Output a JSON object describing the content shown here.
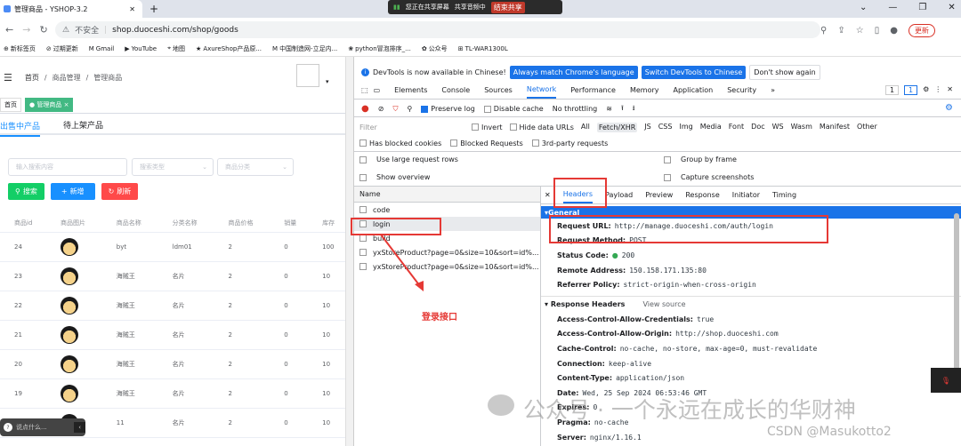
{
  "browser": {
    "tab_title": "管理商品 - YSHOP-3.2",
    "share_status": "您正在共享屏幕",
    "share_audio": "共享音频中",
    "share_stop": "结束共享",
    "security": "不安全",
    "url": "shop.duoceshi.com/shop/goods",
    "update_btn": "更新",
    "bookmarks": [
      "新标签页",
      "过期更新",
      "Gmail",
      "YouTube",
      "地图",
      "AxureShop产品原...",
      "中国制造网-立足内...",
      "python冒泡排序_...",
      "公众号",
      "TL-WAR1300L"
    ]
  },
  "app": {
    "breadcrumb": [
      "首页",
      "商品管理",
      "管理商品"
    ],
    "tags": [
      "首页",
      "管理商品"
    ],
    "subtabs": [
      "出售中产品",
      "待上架产品"
    ],
    "search_placeholder": "输入搜索内容",
    "search_type": "搜索类型",
    "product_category": "商品分类",
    "buttons": {
      "search": "搜索",
      "add": "新增",
      "refresh": "刷新"
    },
    "columns": [
      "商品id",
      "商品图片",
      "商品名称",
      "分类名称",
      "商品价格",
      "销量",
      "库存"
    ],
    "rows": [
      [
        "24",
        "",
        "byt",
        "ldm01",
        "2",
        "0",
        "100"
      ],
      [
        "23",
        "",
        "海贼王",
        "名片",
        "2",
        "0",
        "10"
      ],
      [
        "22",
        "",
        "海贼王",
        "名片",
        "2",
        "0",
        "10"
      ],
      [
        "21",
        "",
        "海贼王",
        "名片",
        "2",
        "0",
        "10"
      ],
      [
        "20",
        "",
        "海贼王",
        "名片",
        "2",
        "0",
        "10"
      ],
      [
        "19",
        "",
        "海贼王",
        "名片",
        "2",
        "0",
        "10"
      ],
      [
        "",
        "",
        "11",
        "名片",
        "2",
        "0",
        "10"
      ]
    ],
    "toast": "说点什么..."
  },
  "devtools": {
    "notice": "DevTools is now available in Chinese!",
    "btn_match": "Always match Chrome's language",
    "btn_switch": "Switch DevTools to Chinese",
    "btn_dont": "Don't show again",
    "tabs": [
      "Elements",
      "Console",
      "Sources",
      "Network",
      "Performance",
      "Memory",
      "Application",
      "Security"
    ],
    "active_tab": "Network",
    "badge1": "1",
    "badge2": "1",
    "preserve_log": "Preserve log",
    "disable_cache": "Disable cache",
    "throttling": "No throttling",
    "filter_placeholder": "Filter",
    "invert": "Invert",
    "hide_data": "Hide data URLs",
    "types": [
      "All",
      "Fetch/XHR",
      "JS",
      "CSS",
      "Img",
      "Media",
      "Font",
      "Doc",
      "WS",
      "Wasm",
      "Manifest",
      "Other"
    ],
    "has_blocked": "Has blocked cookies",
    "blocked_req": "Blocked Requests",
    "third_party": "3rd-party requests",
    "large_rows": "Use large request rows",
    "group_frame": "Group by frame",
    "show_overview": "Show overview",
    "capture": "Capture screenshots",
    "name_col": "Name",
    "requests": [
      "code",
      "login",
      "build",
      "yxStoreProduct?page=0&size=10&sort=id%...",
      "yxStoreProduct?page=0&size=10&sort=id%..."
    ],
    "detail_tabs": [
      "Headers",
      "Payload",
      "Preview",
      "Response",
      "Initiator",
      "Timing"
    ],
    "general_title": "General",
    "general": [
      {
        "k": "Request URL:",
        "v": "http://manage.duoceshi.com/auth/login"
      },
      {
        "k": "Request Method:",
        "v": "POST"
      },
      {
        "k": "Status Code:",
        "v": "200"
      },
      {
        "k": "Remote Address:",
        "v": "150.158.171.135:80"
      },
      {
        "k": "Referrer Policy:",
        "v": "strict-origin-when-cross-origin"
      }
    ],
    "resp_title": "Response Headers",
    "view_source": "View source",
    "response": [
      {
        "k": "Access-Control-Allow-Credentials:",
        "v": "true"
      },
      {
        "k": "Access-Control-Allow-Origin:",
        "v": "http://shop.duoceshi.com"
      },
      {
        "k": "Cache-Control:",
        "v": "no-cache, no-store, max-age=0, must-revalidate"
      },
      {
        "k": "Connection:",
        "v": "keep-alive"
      },
      {
        "k": "Content-Type:",
        "v": "application/json"
      },
      {
        "k": "Date:",
        "v": "Wed, 25 Sep 2024 06:53:46 GMT"
      },
      {
        "k": "Expires:",
        "v": "0"
      },
      {
        "k": "Pragma:",
        "v": "no-cache"
      },
      {
        "k": "Server:",
        "v": "nginx/1.16.1"
      }
    ]
  },
  "annotation": "登录接口",
  "watermark": "公众号 · 一个永远在成长的华财神",
  "csdn": "CSDN @Masukotto2"
}
